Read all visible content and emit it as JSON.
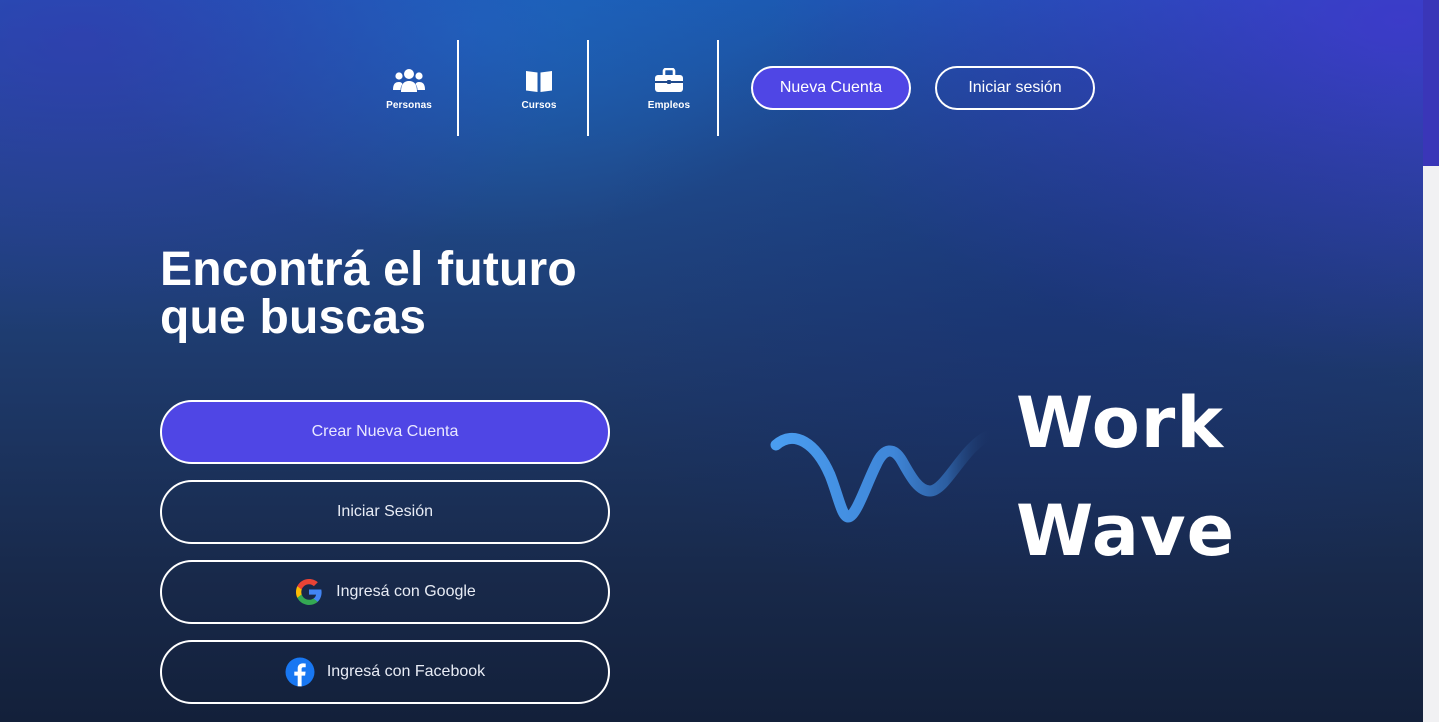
{
  "nav": {
    "items": [
      {
        "label": "Personas",
        "icon": "users-icon"
      },
      {
        "label": "Cursos",
        "icon": "book-icon"
      },
      {
        "label": "Empleos",
        "icon": "briefcase-icon"
      }
    ],
    "new_account_label": "Nueva Cuenta",
    "login_label": "Iniciar sesión"
  },
  "hero": {
    "title_line1": "Encontrá el futuro",
    "title_line2": "que buscas"
  },
  "actions": {
    "create_account": "Crear Nueva Cuenta",
    "login": "Iniciar Sesión",
    "google": "Ingresá con Google",
    "facebook": "Ingresá con Facebook"
  },
  "logo": {
    "line1": "Work",
    "line2": "Wave"
  },
  "colors": {
    "accent": "#4f46e5",
    "wave": "#4a9df0",
    "facebook": "#1877f2"
  }
}
